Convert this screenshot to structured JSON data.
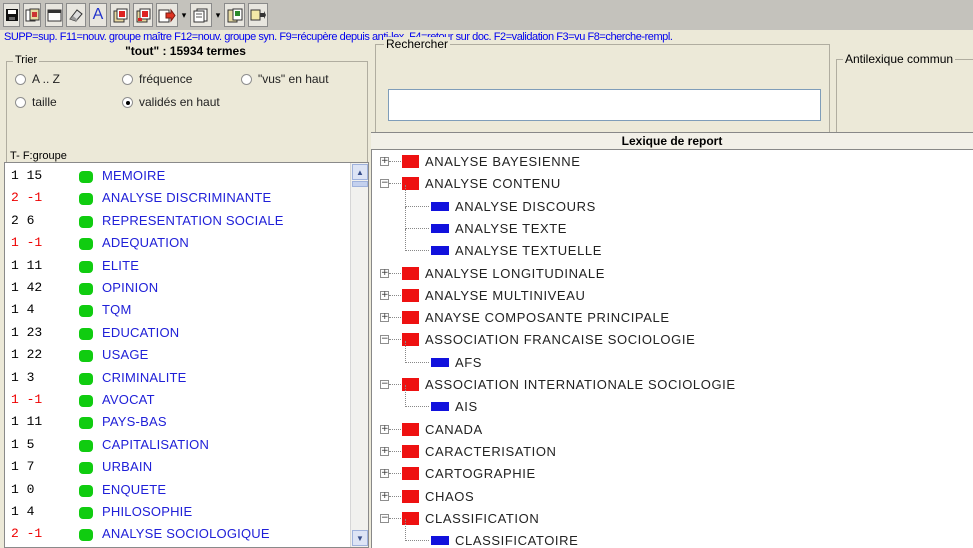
{
  "toolbar": {
    "buttons": [
      {
        "name": "save-icon"
      },
      {
        "name": "copy-book-icon"
      },
      {
        "name": "window-icon"
      },
      {
        "name": "eraser-icon"
      },
      {
        "name": "font-icon",
        "text": "A"
      },
      {
        "name": "new-master-group-icon"
      },
      {
        "name": "new-syn-group-icon"
      },
      {
        "name": "export-arrow-icon"
      },
      {
        "name": "pages-icon"
      },
      {
        "name": "book-copy-icon"
      },
      {
        "name": "move-list-icon"
      }
    ]
  },
  "shortcuts_text": "SUPP=sup. F11=nouv. groupe maître F12=nouv. groupe syn. F9=récupère depuis anti-lex. F4=retour sur doc. F2=validation F3=vu F8=cherche-rempl.",
  "count_label": "\"tout\" : 15934 termes",
  "trier": {
    "legend": "Trier",
    "options": [
      {
        "label": "A .. Z",
        "checked": false
      },
      {
        "label": "fréquence",
        "checked": false
      },
      {
        "label": "\"vus\" en haut",
        "checked": false
      },
      {
        "label": "taille",
        "checked": false
      },
      {
        "label": "validés en haut",
        "checked": true
      }
    ]
  },
  "list_header": "T- F:groupe",
  "terms": [
    {
      "t": "1",
      "f": "15",
      "label": "MEMOIRE",
      "color": "#000000"
    },
    {
      "t": "2",
      "f": "-1",
      "label": "ANALYSE DISCRIMINANTE",
      "color": "#ee0000"
    },
    {
      "t": "2",
      "f": "6",
      "label": "REPRESENTATION SOCIALE",
      "color": "#000000"
    },
    {
      "t": "1",
      "f": "-1",
      "label": "ADEQUATION",
      "color": "#ee0000"
    },
    {
      "t": "1",
      "f": "11",
      "label": "ELITE",
      "color": "#000000"
    },
    {
      "t": "1",
      "f": "42",
      "label": "OPINION",
      "color": "#000000"
    },
    {
      "t": "1",
      "f": "4",
      "label": "TQM",
      "color": "#000000"
    },
    {
      "t": "1",
      "f": "23",
      "label": "EDUCATION",
      "color": "#000000"
    },
    {
      "t": "1",
      "f": "22",
      "label": "USAGE",
      "color": "#000000"
    },
    {
      "t": "1",
      "f": "3",
      "label": "CRIMINALITE",
      "color": "#000000"
    },
    {
      "t": "1",
      "f": "-1",
      "label": "AVOCAT",
      "color": "#ee0000"
    },
    {
      "t": "1",
      "f": "11",
      "label": "PAYS-BAS",
      "color": "#000000"
    },
    {
      "t": "1",
      "f": "5",
      "label": "CAPITALISATION",
      "color": "#000000"
    },
    {
      "t": "1",
      "f": "7",
      "label": "URBAIN",
      "color": "#000000"
    },
    {
      "t": "1",
      "f": "0",
      "label": "ENQUETE",
      "color": "#000000"
    },
    {
      "t": "1",
      "f": "4",
      "label": "PHILOSOPHIE",
      "color": "#000000"
    },
    {
      "t": "2",
      "f": "-1",
      "label": "ANALYSE SOCIOLOGIQUE",
      "color": "#ee0000"
    }
  ],
  "search": {
    "legend": "Rechercher",
    "value": ""
  },
  "antilexique": {
    "legend": "Antilexique commun"
  },
  "lexique_header": "Lexique de report",
  "tree": [
    {
      "kind": "parent",
      "expand": "+",
      "label": "ANALYSE BAYESIENNE"
    },
    {
      "kind": "parent",
      "expand": "−",
      "label": "ANALYSE CONTENU"
    },
    {
      "kind": "child",
      "label": "ANALYSE DISCOURS"
    },
    {
      "kind": "child",
      "label": "ANALYSE TEXTE"
    },
    {
      "kind": "child",
      "label": "ANALYSE TEXTUELLE"
    },
    {
      "kind": "parent",
      "expand": "+",
      "label": "ANALYSE LONGITUDINALE"
    },
    {
      "kind": "parent",
      "expand": "+",
      "label": "ANALYSE MULTINIVEAU"
    },
    {
      "kind": "parent",
      "expand": "+",
      "label": "ANAYSE COMPOSANTE PRINCIPALE"
    },
    {
      "kind": "parent",
      "expand": "−",
      "label": "ASSOCIATION FRANCAISE SOCIOLOGIE"
    },
    {
      "kind": "child",
      "label": "AFS"
    },
    {
      "kind": "parent",
      "expand": "−",
      "label": "ASSOCIATION INTERNATIONALE SOCIOLOGIE"
    },
    {
      "kind": "child",
      "label": "AIS"
    },
    {
      "kind": "parent",
      "expand": "+",
      "label": "CANADA"
    },
    {
      "kind": "parent",
      "expand": "+",
      "label": "CARACTERISATION"
    },
    {
      "kind": "parent",
      "expand": "+",
      "label": "CARTOGRAPHIE"
    },
    {
      "kind": "parent",
      "expand": "+",
      "label": "CHAOS"
    },
    {
      "kind": "parent",
      "expand": "−",
      "label": "CLASSIFICATION"
    },
    {
      "kind": "child",
      "label": "CLASSIFICATOIRE"
    }
  ]
}
